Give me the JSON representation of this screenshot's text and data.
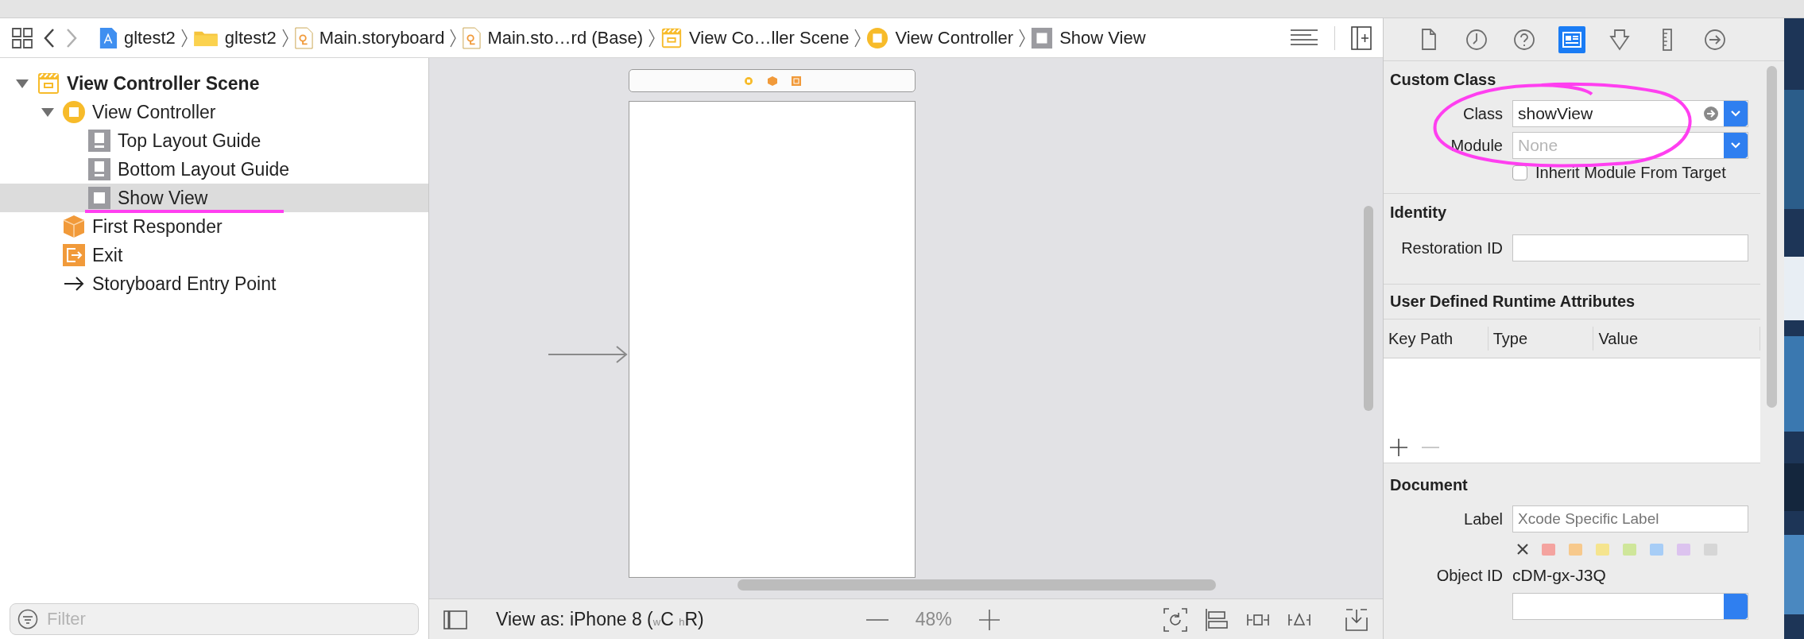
{
  "breadcrumbs": [
    {
      "label": "gltest2",
      "kind": "project"
    },
    {
      "label": "gltest2",
      "kind": "folder"
    },
    {
      "label": "Main.storyboard",
      "kind": "storyboard"
    },
    {
      "label": "Main.sto…rd (Base)",
      "kind": "storyboard"
    },
    {
      "label": "View Co…ller Scene",
      "kind": "scene"
    },
    {
      "label": "View Controller",
      "kind": "controller"
    },
    {
      "label": "Show View",
      "kind": "view"
    }
  ],
  "outline": [
    {
      "label": "View Controller Scene",
      "kind": "scene",
      "expanded": true,
      "selected": false,
      "children": [
        {
          "label": "View Controller",
          "kind": "controller",
          "expanded": true,
          "selected": false,
          "children": [
            {
              "label": "Top Layout Guide",
              "kind": "guide",
              "selected": false
            },
            {
              "label": "Bottom Layout Guide",
              "kind": "guide",
              "selected": false
            },
            {
              "label": "Show View",
              "kind": "view",
              "selected": true
            }
          ]
        },
        {
          "label": "First Responder",
          "kind": "responder",
          "selected": false
        },
        {
          "label": "Exit",
          "kind": "exit",
          "selected": false
        },
        {
          "label": "Storyboard Entry Point",
          "kind": "entry",
          "selected": false
        }
      ]
    }
  ],
  "filter": {
    "placeholder": "Filter"
  },
  "canvas": {
    "view_as": "View as: iPhone 8 ($_{w}$C $_{h}$R)",
    "zoom": "48%"
  },
  "inspector_tabs": [
    {
      "kind": "file",
      "selected": false
    },
    {
      "kind": "history",
      "selected": false
    },
    {
      "kind": "help",
      "selected": false
    },
    {
      "kind": "identity",
      "selected": true
    },
    {
      "kind": "attributes",
      "selected": false
    },
    {
      "kind": "size",
      "selected": false
    },
    {
      "kind": "connections",
      "selected": false
    }
  ],
  "custom_class": {
    "title": "Custom Class",
    "class_label": "Class",
    "class_value": "showView",
    "module_label": "Module",
    "module_placeholder": "None",
    "inherit_label": "Inherit Module From Target",
    "inherit_checked": false
  },
  "identity": {
    "title": "Identity",
    "restoration_label": "Restoration ID"
  },
  "runtime_attributes": {
    "title": "User Defined Runtime Attributes",
    "columns": [
      "Key Path",
      "Type",
      "Value"
    ]
  },
  "document": {
    "title": "Document",
    "label_label": "Label",
    "label_placeholder": "Xcode Specific Label",
    "swatches": [
      {
        "color": "#f4a39f",
        "selected": false
      },
      {
        "color": "#f7c98c",
        "selected": false
      },
      {
        "color": "#f5e48e",
        "selected": false
      },
      {
        "color": "#cfe69a",
        "selected": false
      },
      {
        "color": "#a7cdf6",
        "selected": false
      },
      {
        "color": "#dcc3ef",
        "selected": false
      },
      {
        "color": "#d6d6d6",
        "selected": false
      }
    ],
    "object_id_label": "Object ID",
    "object_id": "cDM-gx-J3Q"
  },
  "annotations": [
    {
      "kind": "ellipse"
    },
    {
      "kind": "underline"
    }
  ]
}
